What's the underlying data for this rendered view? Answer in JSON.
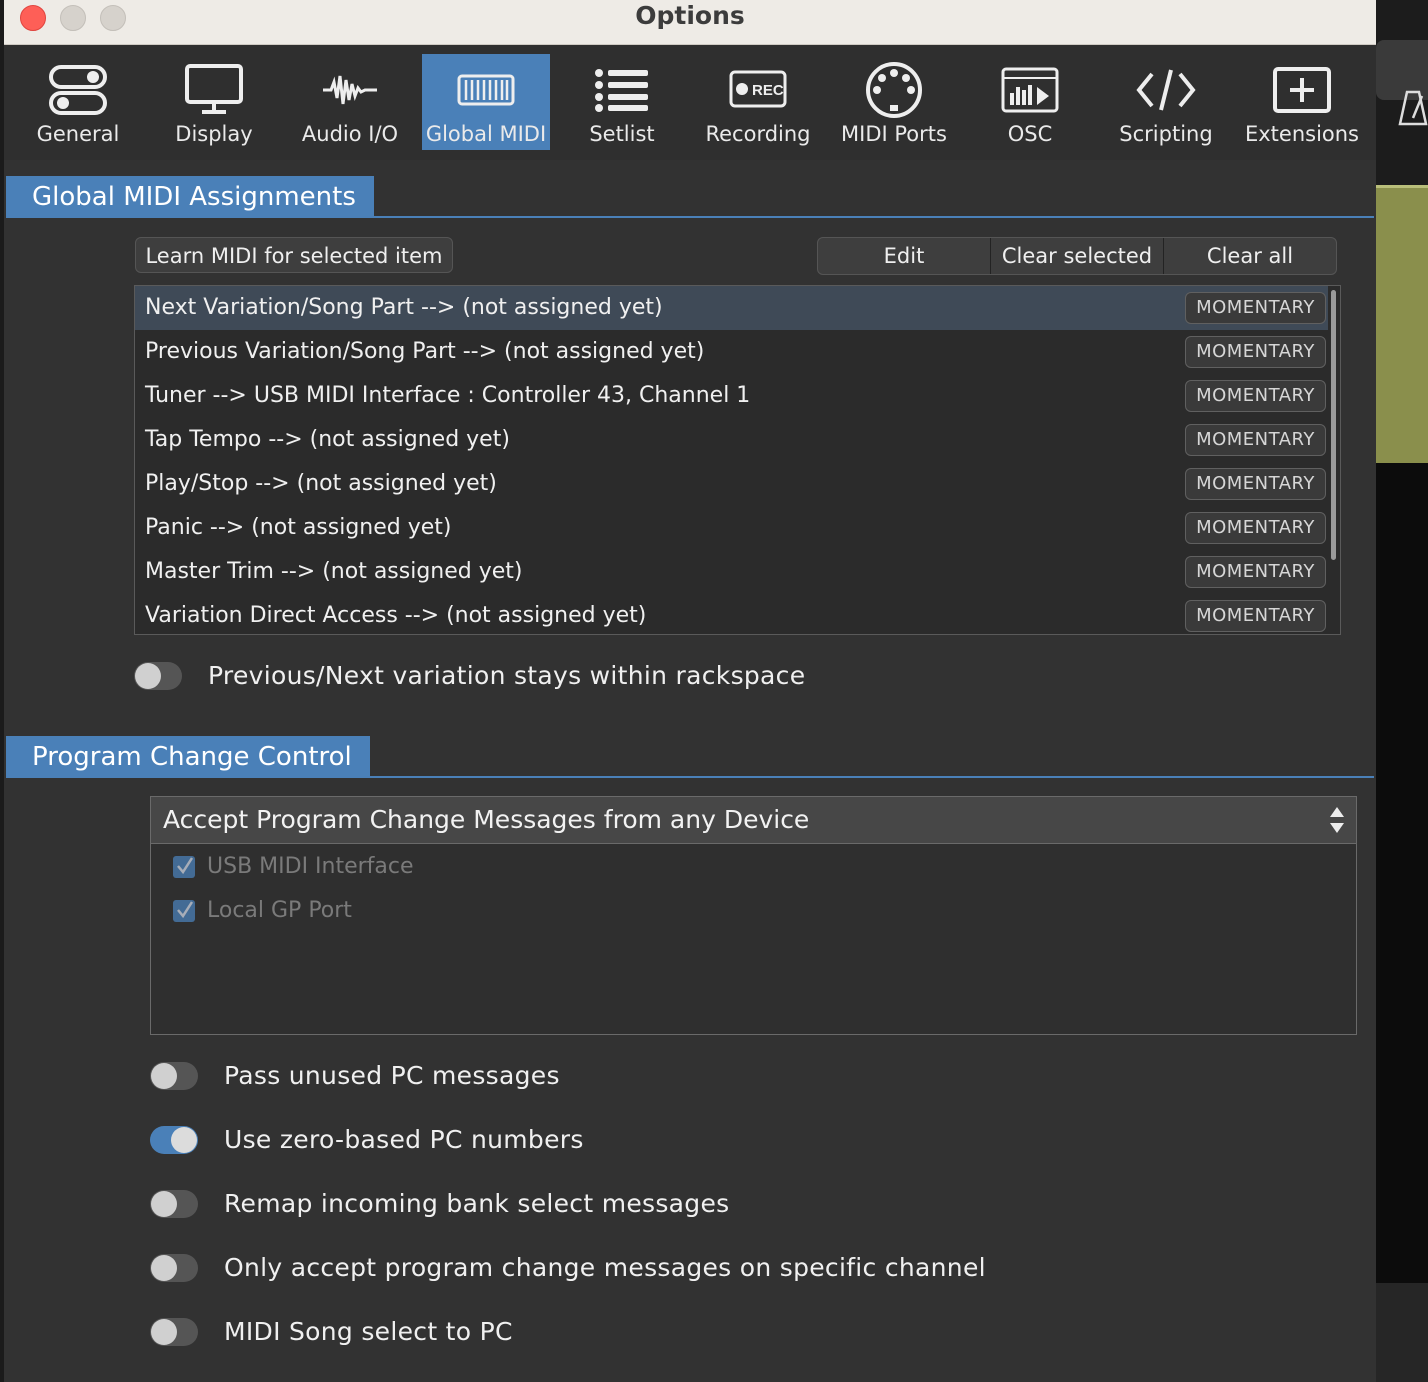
{
  "window": {
    "title": "Options"
  },
  "tabs": [
    {
      "label": "General",
      "icon": "general-toggles-icon"
    },
    {
      "label": "Display",
      "icon": "monitor-icon"
    },
    {
      "label": "Audio I/O",
      "icon": "waveform-icon"
    },
    {
      "label": "Global MIDI",
      "icon": "midi-keyboard-icon",
      "active": true
    },
    {
      "label": "Setlist",
      "icon": "list-icon"
    },
    {
      "label": "Recording",
      "icon": "rec-icon",
      "icon_text": "REC"
    },
    {
      "label": "MIDI Ports",
      "icon": "midi-port-icon"
    },
    {
      "label": "OSC",
      "icon": "osc-icon"
    },
    {
      "label": "Scripting",
      "icon": "code-icon",
      "icon_text": "</>"
    },
    {
      "label": "Extensions",
      "icon": "plus-box-icon",
      "icon_text": "+"
    }
  ],
  "global_midi": {
    "heading": "Global MIDI Assignments",
    "learn_button": "Learn MIDI for selected item",
    "edit_button": "Edit",
    "clear_selected_button": "Clear selected",
    "clear_all_button": "Clear all",
    "assignments": [
      {
        "text": "Next Variation/Song Part --> (not assigned yet)",
        "mode": "MOMENTARY",
        "selected": true
      },
      {
        "text": "Previous Variation/Song Part --> (not assigned yet)",
        "mode": "MOMENTARY"
      },
      {
        "text": "Tuner --> USB MIDI Interface : Controller 43, Channel 1",
        "mode": "MOMENTARY"
      },
      {
        "text": "Tap Tempo --> (not assigned yet)",
        "mode": "MOMENTARY"
      },
      {
        "text": "Play/Stop --> (not assigned yet)",
        "mode": "MOMENTARY"
      },
      {
        "text": "Panic --> (not assigned yet)",
        "mode": "MOMENTARY"
      },
      {
        "text": "Master Trim --> (not assigned yet)",
        "mode": "MOMENTARY"
      },
      {
        "text": "Variation Direct Access --> (not assigned yet)",
        "mode": "MOMENTARY"
      }
    ],
    "stay_within_rackspace": {
      "label": "Previous/Next variation stays within rackspace",
      "on": false
    }
  },
  "program_change": {
    "heading": "Program Change Control",
    "source_select": "Accept Program Change Messages from any Device",
    "devices": [
      {
        "label": "USB MIDI Interface",
        "checked": true,
        "disabled": true
      },
      {
        "label": "Local GP Port",
        "checked": true,
        "disabled": true
      }
    ],
    "options": [
      {
        "label": "Pass unused PC messages",
        "on": false
      },
      {
        "label": "Use zero-based PC numbers",
        "on": true
      },
      {
        "label": "Remap incoming bank select messages",
        "on": false
      },
      {
        "label": "Only accept program change messages on specific channel",
        "on": false
      },
      {
        "label": "MIDI Song select to PC",
        "on": false
      }
    ]
  },
  "colors": {
    "accent": "#4a80b8",
    "window_bg": "#323232",
    "close_button": "#fe5f57"
  }
}
